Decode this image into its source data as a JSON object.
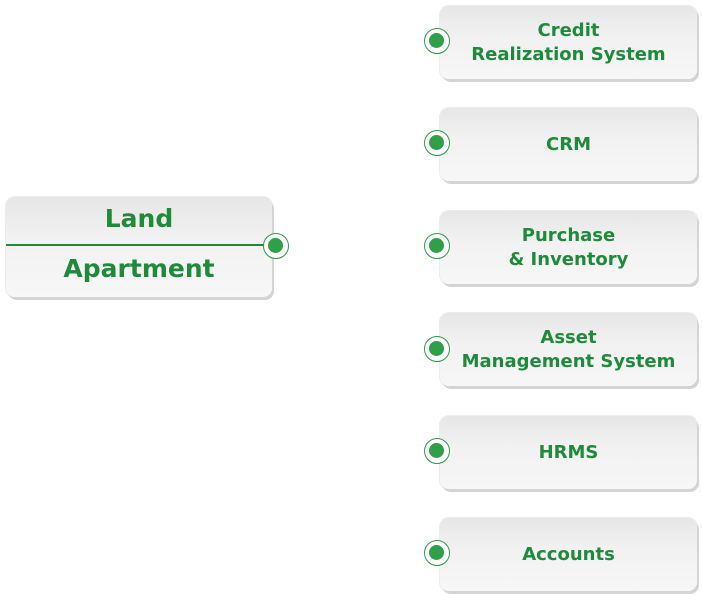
{
  "main": {
    "line1": "Land",
    "line2": "Apartment"
  },
  "modules": [
    {
      "lines": [
        "Credit",
        "Realization System"
      ]
    },
    {
      "lines": [
        "CRM"
      ]
    },
    {
      "lines": [
        "Purchase",
        "& Inventory"
      ]
    },
    {
      "lines": [
        "Asset",
        "Management System"
      ]
    },
    {
      "lines": [
        "HRMS"
      ]
    },
    {
      "lines": [
        "Accounts"
      ]
    }
  ],
  "colors": {
    "accent": "#1e8a3a",
    "node_fill": "#2fa047",
    "box_top": "#e6e6e6",
    "box_bottom": "#f7f7f7"
  }
}
